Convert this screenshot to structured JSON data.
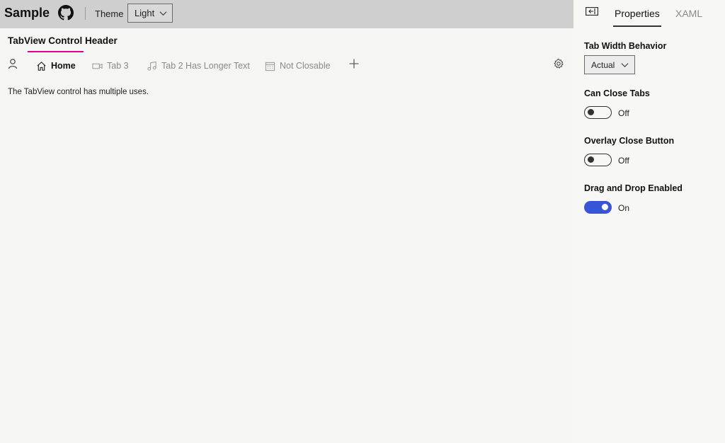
{
  "header": {
    "app_title": "Sample",
    "theme_label": "Theme",
    "theme_value": "Light"
  },
  "main": {
    "tabview_header": "TabView Control Header",
    "tabs": [
      {
        "label": "Home",
        "icon": "home-icon",
        "active": true
      },
      {
        "label": "Tab 3",
        "icon": "video-icon",
        "active": false
      },
      {
        "label": "Tab 2 Has Longer Text",
        "icon": "music-icon",
        "active": false
      },
      {
        "label": "Not Closable",
        "icon": "calendar-icon",
        "active": false
      }
    ],
    "content_text": "The TabView control has multiple uses."
  },
  "pane": {
    "tabs": [
      "Properties",
      "XAML"
    ],
    "properties": {
      "tab_width_behavior": {
        "label": "Tab Width Behavior",
        "value": "Actual"
      },
      "can_close_tabs": {
        "label": "Can Close Tabs",
        "state": "Off"
      },
      "overlay_close_button": {
        "label": "Overlay Close Button",
        "state": "Off"
      },
      "drag_and_drop_enabled": {
        "label": "Drag and Drop Enabled",
        "state": "On"
      }
    }
  },
  "colors": {
    "accent": "#3a54d6",
    "header_underline": "#e3008c",
    "topbar": "#cfcfcf"
  }
}
